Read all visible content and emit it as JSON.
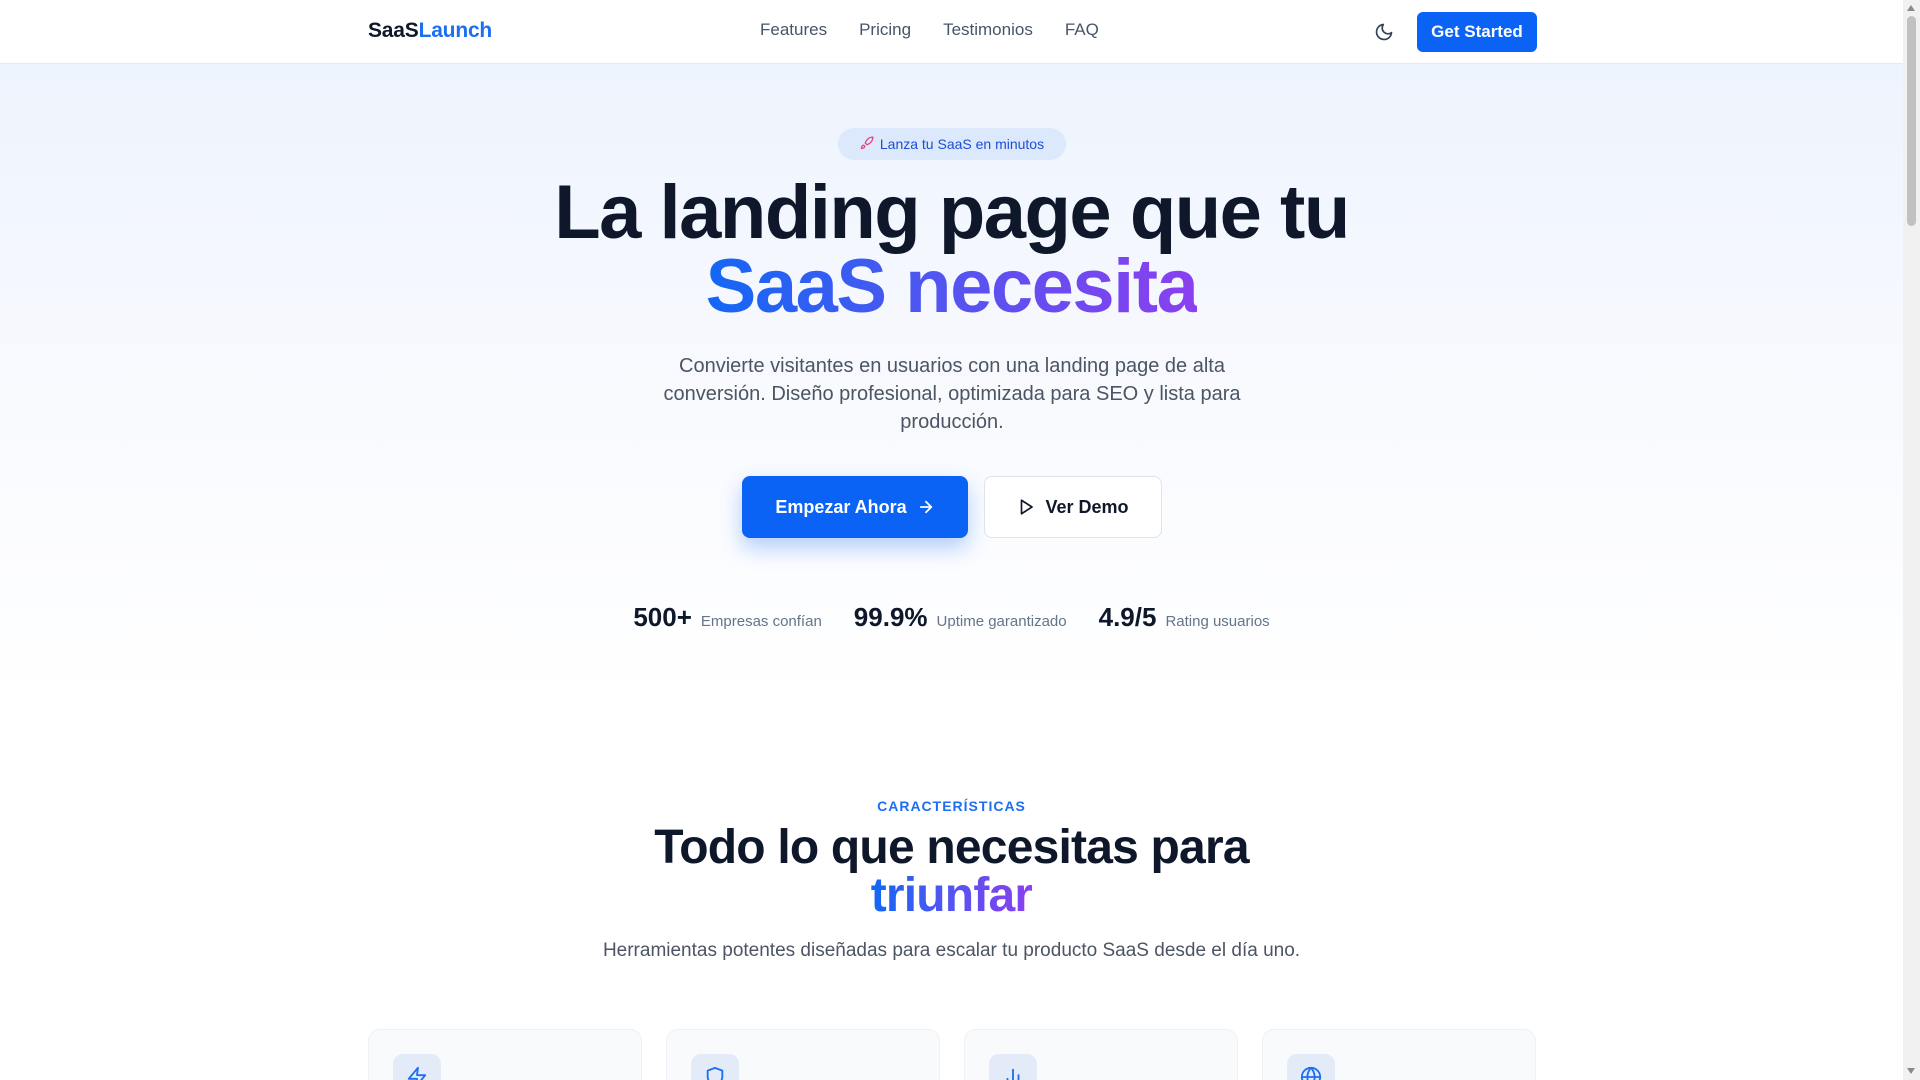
{
  "nav": {
    "brand_part1": "SaaS",
    "brand_part2": "Launch",
    "links": [
      "Features",
      "Pricing",
      "Testimonios",
      "FAQ"
    ],
    "theme_toggle_icon": "moon-icon",
    "cta": "Get Started"
  },
  "hero": {
    "badge_icon": "rocket-icon",
    "badge": "Lanza tu SaaS en minutos",
    "title_line1": "La landing page que tu",
    "title_line2": "SaaS necesita",
    "subtitle": "Convierte visitantes en usuarios con una landing page de alta conversión. Diseño profesional, optimizada para SEO y lista para producción.",
    "primary_button": "Empezar Ahora",
    "secondary_button": "Ver Demo",
    "stats": [
      {
        "value": "500+",
        "label": "Empresas confían"
      },
      {
        "value": "99.9%",
        "label": "Uptime garantizado"
      },
      {
        "value": "4.9/5",
        "label": "Rating usuarios"
      }
    ]
  },
  "features": {
    "eyebrow": "CARACTERÍSTICAS",
    "title_line1": "Todo lo que necesitas para",
    "title_line2": "triunfar",
    "subtitle": "Herramientas potentes diseñadas para escalar tu producto SaaS desde el día uno.",
    "card_icons": [
      "lightning-icon",
      "shield-icon",
      "bar-chart-icon",
      "globe-icon"
    ]
  },
  "colors": {
    "accent": "#0b63f6",
    "gradient_start": "#1367f5",
    "gradient_end": "#8b3ff0",
    "text": "#0f172a",
    "muted": "#4b5563"
  }
}
